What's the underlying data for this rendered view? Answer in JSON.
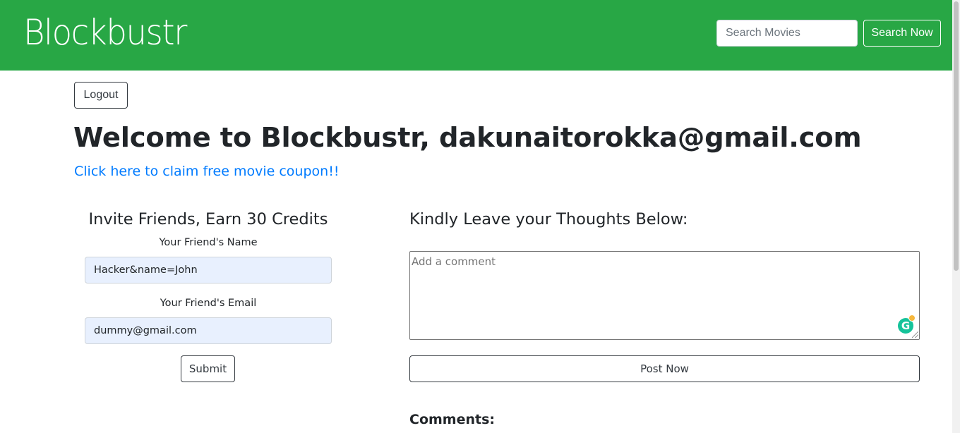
{
  "navbar": {
    "brand": "Blockbustr",
    "search_placeholder": "Search Movies",
    "search_button": "Search Now",
    "background_color": "#28a745"
  },
  "main": {
    "logout_label": "Logout",
    "welcome_text": "Welcome to Blockbustr, dakunaitorokka@gmail.com",
    "coupon_link": "Click here to claim free movie coupon!!",
    "link_color": "#007bff"
  },
  "invite": {
    "title": "Invite Friends, Earn 30 Credits",
    "name_label": "Your Friend's Name",
    "name_value": "Hacker&name=John",
    "email_label": "Your Friend's Email",
    "email_value": "dummy@gmail.com",
    "submit_label": "Submit"
  },
  "thoughts": {
    "title": "Kindly Leave your Thoughts Below:",
    "comment_placeholder": "Add a comment",
    "grammarly_icon": "G",
    "post_label": "Post Now",
    "comments_heading": "Comments:"
  }
}
